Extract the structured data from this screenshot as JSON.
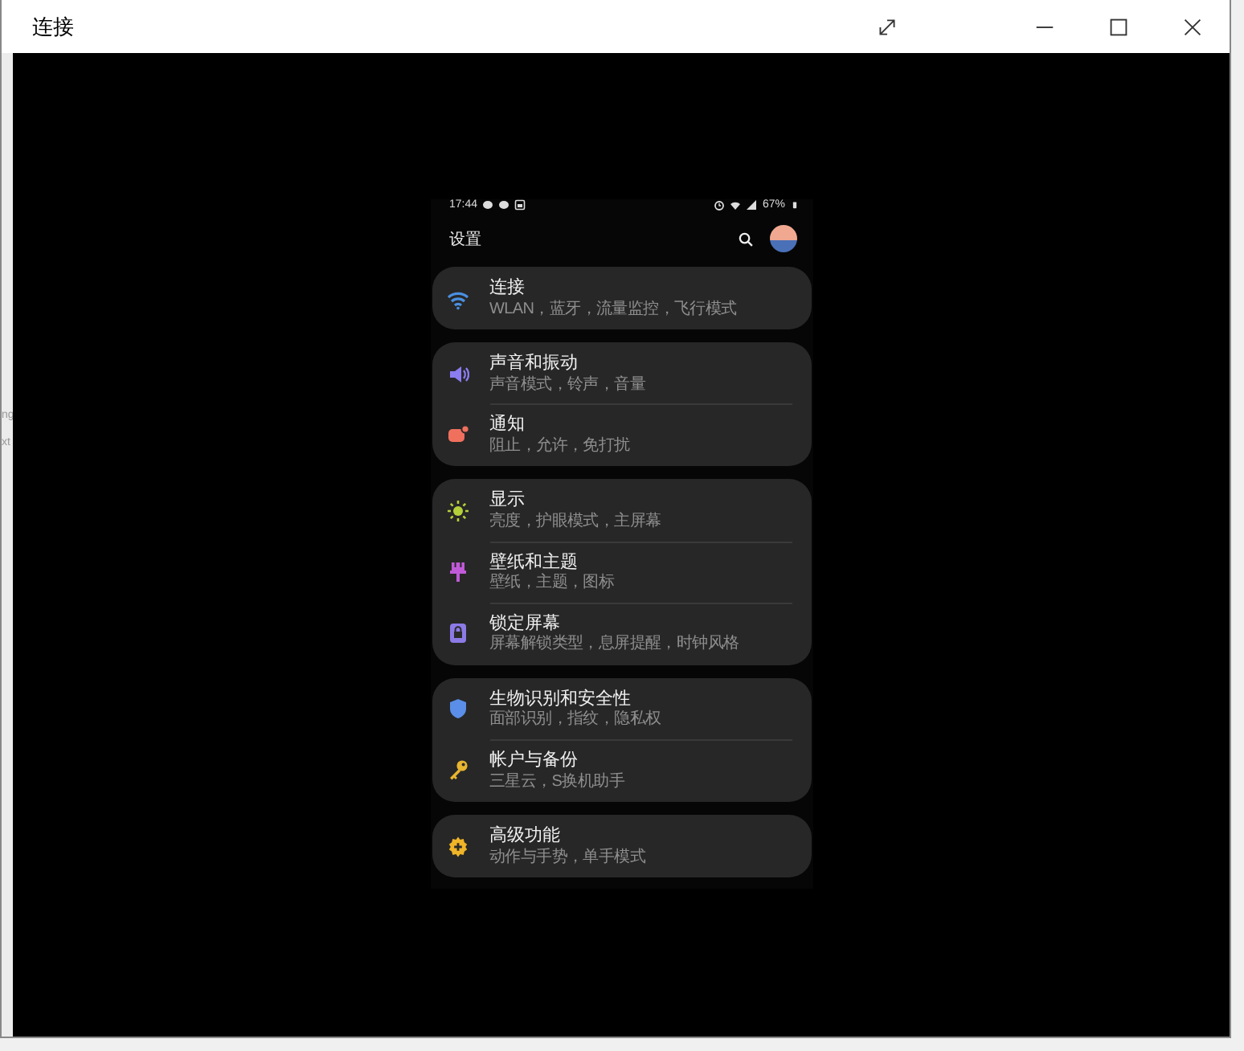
{
  "window": {
    "title": "连接"
  },
  "background_fragments": [
    "ng",
    "xt"
  ],
  "phone": {
    "status_bar": {
      "time": "17:44",
      "battery": "67%"
    },
    "header": {
      "title": "设置"
    },
    "groups": [
      {
        "items": [
          {
            "title": "连接",
            "subtitle": "WLAN，蓝牙，流量监控，飞行模式"
          }
        ]
      },
      {
        "items": [
          {
            "title": "声音和振动",
            "subtitle": "声音模式，铃声，音量"
          },
          {
            "title": "通知",
            "subtitle": "阻止，允许，免打扰"
          }
        ]
      },
      {
        "items": [
          {
            "title": "显示",
            "subtitle": "亮度，护眼模式，主屏幕"
          },
          {
            "title": "壁纸和主题",
            "subtitle": "壁纸，主题，图标"
          },
          {
            "title": "锁定屏幕",
            "subtitle": "屏幕解锁类型，息屏提醒，时钟风格"
          }
        ]
      },
      {
        "items": [
          {
            "title": "生物识别和安全性",
            "subtitle": "面部识别，指纹，隐私权"
          },
          {
            "title": "帐户与备份",
            "subtitle": "三星云，S换机助手"
          }
        ]
      },
      {
        "items": [
          {
            "title": "高级功能",
            "subtitle": "动作与手势，单手模式"
          }
        ]
      }
    ]
  }
}
